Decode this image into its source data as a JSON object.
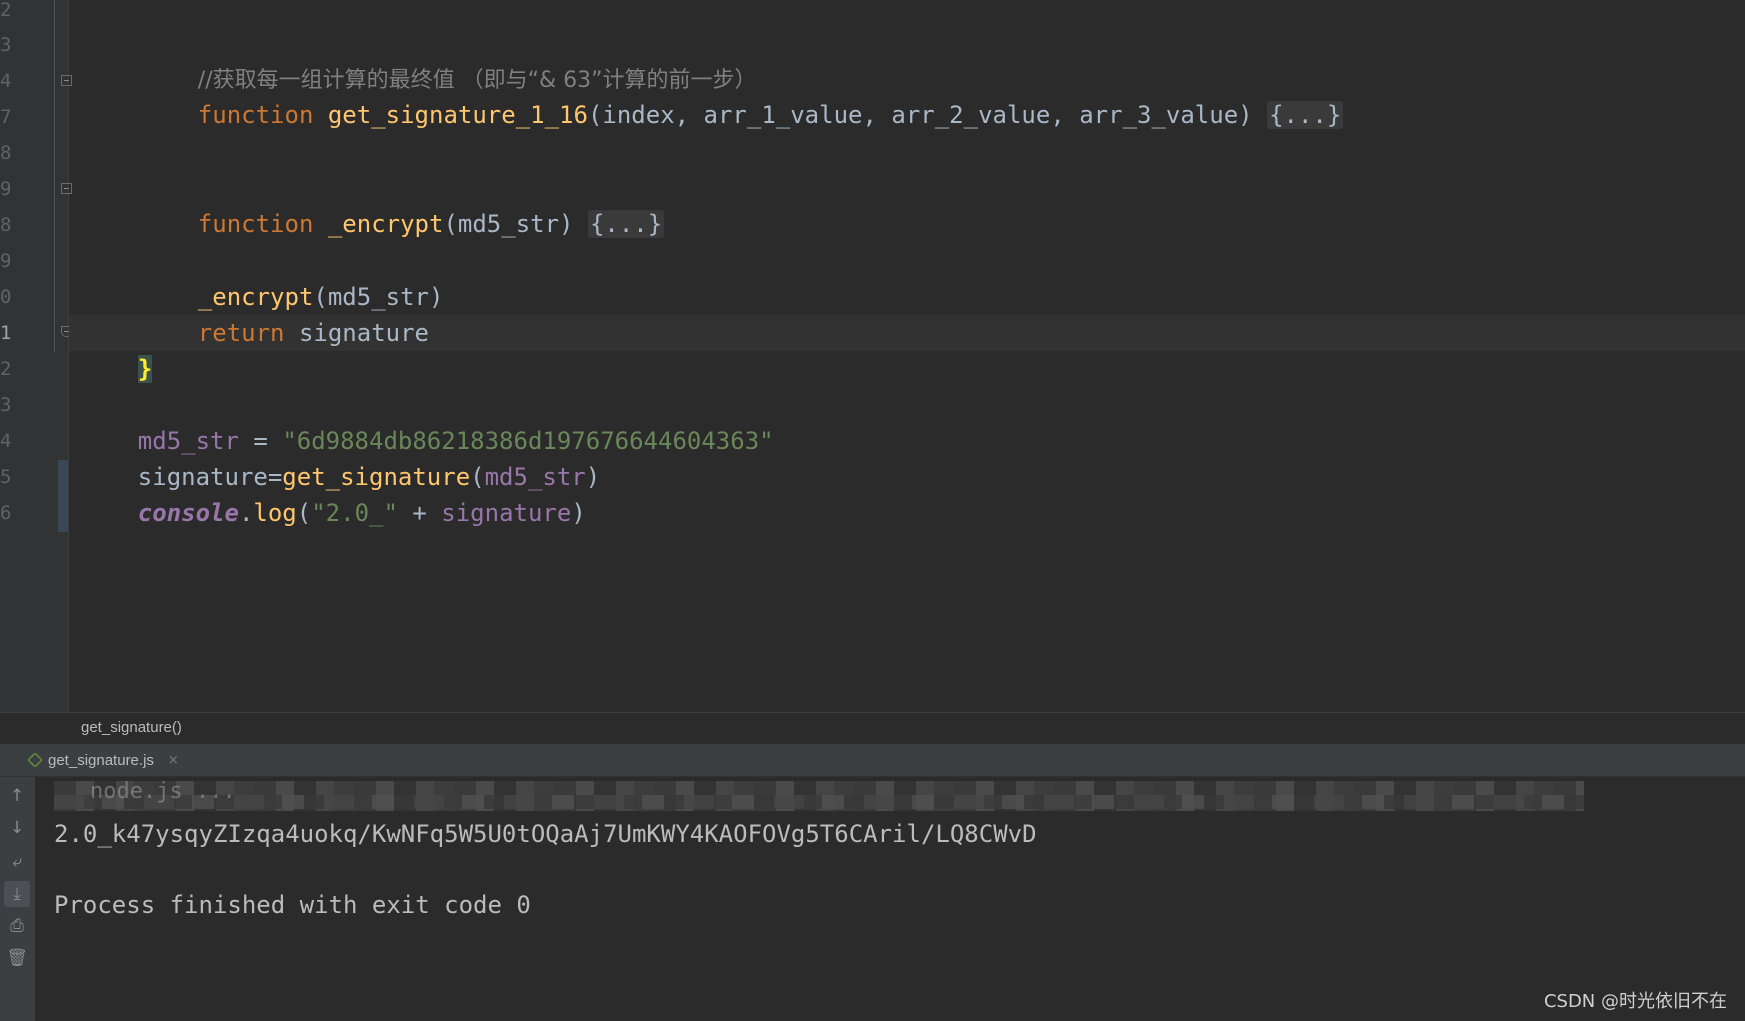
{
  "gutter": {
    "line_numbers": [
      "2",
      "3",
      "4",
      "7",
      "8",
      "9",
      "8",
      "9",
      "0",
      "1",
      "2",
      "3",
      "4",
      "5",
      "6"
    ]
  },
  "code": {
    "comment": "//获取每一组计算的最终值 （即与“& 63”计算的前一步）",
    "line1": {
      "kw": "function",
      "fn": "get_signature_1_16",
      "open": "(",
      "params": "index, arr_1_value, arr_2_value, arr_3_value",
      "close": ") ",
      "collapsed": "{...}"
    },
    "line2": {
      "kw": "function",
      "fn": "_encrypt",
      "open": "(",
      "params": "md5_str",
      "close": ") ",
      "collapsed": "{...}"
    },
    "line3": {
      "fn": "_encrypt",
      "args": "(md5_str)"
    },
    "line4": {
      "kw": "return",
      "rest": " signature"
    },
    "close_brace": "}",
    "line5": {
      "var": "md5_str",
      "eq": " = ",
      "str": "\"6d9884db86218386d197676644604363\""
    },
    "line6": {
      "lhs": "signature=",
      "fn": "get_signature",
      "open": "(",
      "arg": "md5_str",
      "close": ")"
    },
    "line7": {
      "obj": "console",
      "dot": ".",
      "fn": "log",
      "open": "(",
      "str": "\"2.0_\"",
      "plus": " + ",
      "arg": "signature",
      "close": ")"
    }
  },
  "breadcrumb": {
    "label": "get_signature()"
  },
  "run_tab": {
    "label": "get_signature.js",
    "close": "×"
  },
  "console": {
    "obscured": "node.js ...",
    "output": "2.0_k47ysqyZIzqa4uokq/KwNFq5W5U0tOQaAj7UmKWY4KAOFOVg5T6CAril/LQ8CWvD",
    "exit": "Process finished with exit code 0"
  },
  "toolbar": {
    "icons": [
      "up-arrow-icon",
      "down-arrow-icon",
      "soft-wrap-icon",
      "scroll-to-end-icon",
      "print-icon",
      "trash-icon"
    ]
  },
  "watermark": "CSDN @时光依旧不在"
}
